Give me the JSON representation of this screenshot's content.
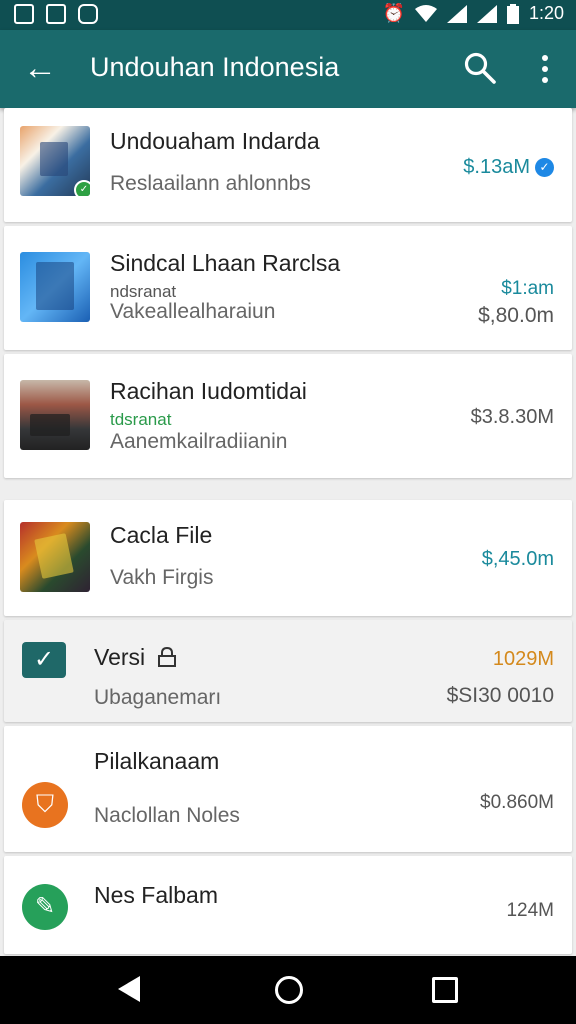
{
  "status_bar": {
    "time": "1:20"
  },
  "app_bar": {
    "title": "Undouhan Indonesia"
  },
  "items": [
    {
      "title": "Undouaham Indarda",
      "subtitle": "Reslaailann ahlonnbs",
      "right": "$.13aM",
      "verified": true
    },
    {
      "title": "Sindcal Lhaan Rarclsa",
      "small": "ndsranat",
      "subtitle": "Vakeallealharaiun",
      "right_top": "$1:am",
      "right_bottom": "$,80.0m"
    },
    {
      "title": "Racihan Iudomtidai",
      "small": "tdsranat",
      "subtitle": "Aanemkailradiianin",
      "right": "$3.8.30M"
    },
    {
      "title": "Cacla File",
      "subtitle": "Vakh Firgis",
      "right": "$,45.0m"
    },
    {
      "title": "Versi",
      "subtitle": "Ubaganemarı",
      "right_top": "1029M",
      "right_bottom": "$SI30 0010"
    },
    {
      "title": "Pilalkanaam",
      "subtitle": "Naclollan Noles",
      "right": "$0.860M"
    },
    {
      "title": "Nes Falbam",
      "right": "124M"
    }
  ],
  "colors": {
    "statusbar": "#0f4f52",
    "appbar": "#1a6a6c",
    "teal_price": "#1a8a9c",
    "orange_size": "#d4891c"
  }
}
